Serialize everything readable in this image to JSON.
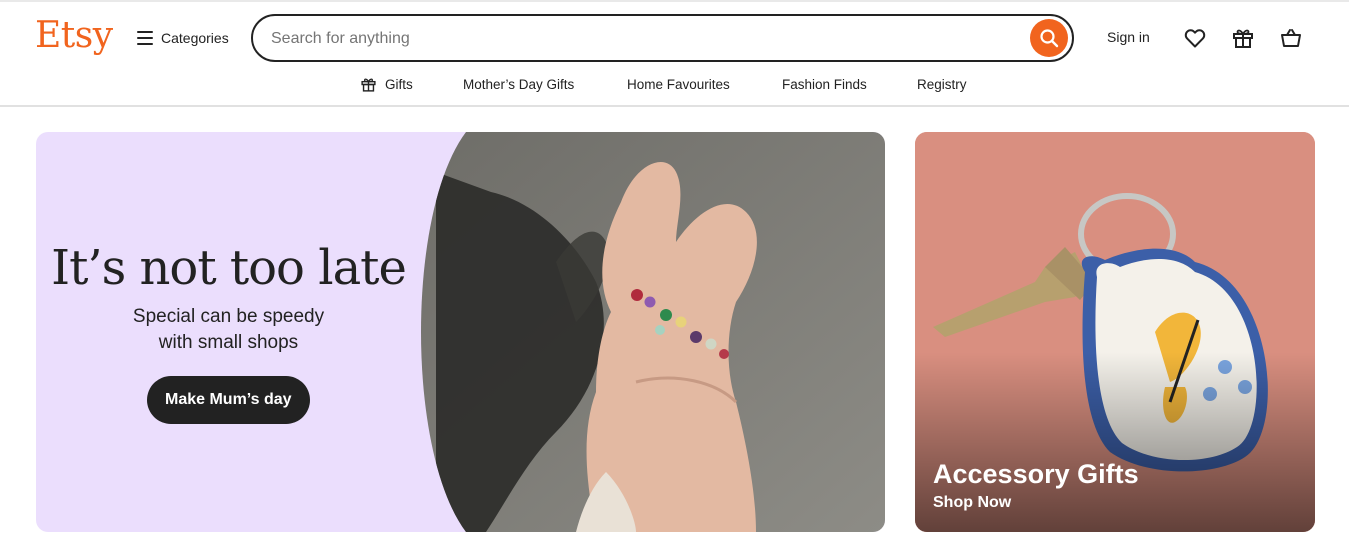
{
  "header": {
    "logo": "Etsy",
    "categories_label": "Categories",
    "search": {
      "placeholder": "Search for anything",
      "value": ""
    },
    "sign_in": "Sign in",
    "icons": [
      "menu-icon",
      "search-icon",
      "heart-icon",
      "gift-icon",
      "bag-icon"
    ]
  },
  "nav": {
    "items": [
      {
        "label": "Gifts",
        "icon": "gift-icon"
      },
      {
        "label": "Mother’s Day Gifts"
      },
      {
        "label": "Home Favourites"
      },
      {
        "label": "Fashion Finds"
      },
      {
        "label": "Registry"
      }
    ]
  },
  "hero": {
    "title": "It’s not too late",
    "subtitle_line1": "Special can be speedy",
    "subtitle_line2": "with small shops",
    "cta": "Make Mum’s day",
    "background_color": "#ebdefd"
  },
  "promo": {
    "title": "Accessory Gifts",
    "link": "Shop Now"
  },
  "colors": {
    "brand": "#f1641e",
    "text": "#222222",
    "hero_bg": "#ebdefd",
    "promo_bg": "#d98f80"
  }
}
